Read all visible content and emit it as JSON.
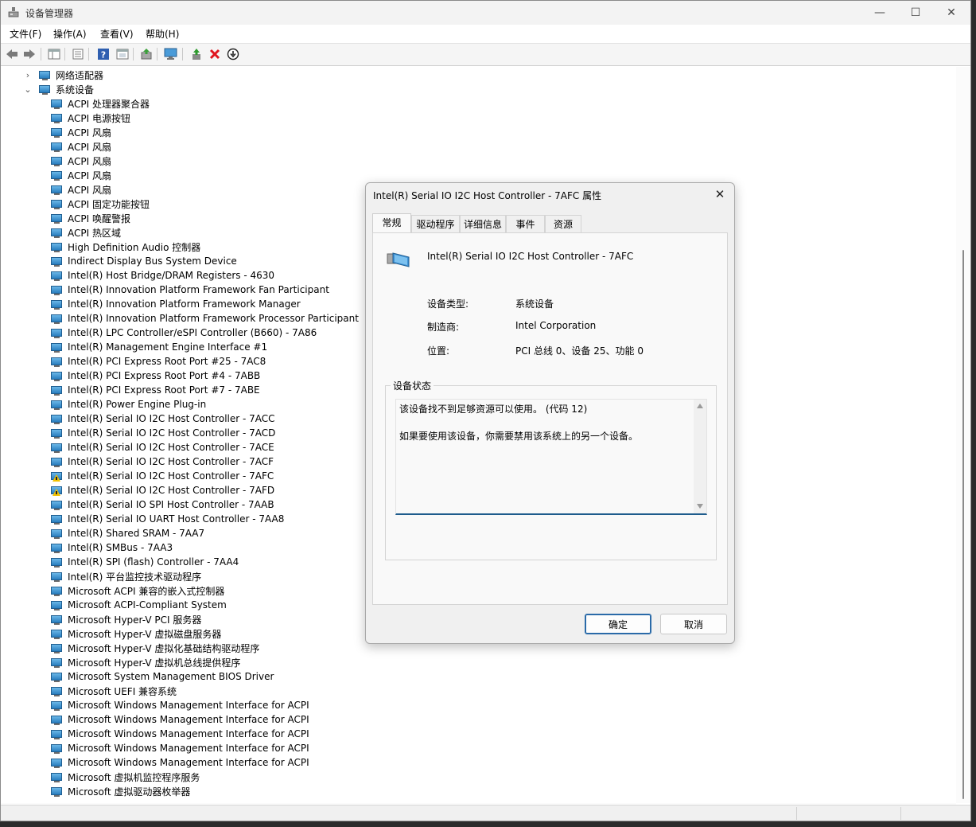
{
  "window": {
    "title": "设备管理器",
    "controls": {
      "minimize": "—",
      "maximize": "☐",
      "close": "✕"
    }
  },
  "menu": [
    "文件(F)",
    "操作(A)",
    "查看(V)",
    "帮助(H)"
  ],
  "toolbar": [
    "back-icon",
    "forward-icon",
    "properties-icon",
    "list-icon",
    "help-icon",
    "view-icon",
    "update-driver-icon",
    "monitor-icon",
    "enable-device-icon",
    "uninstall-icon",
    "disable-device-icon"
  ],
  "tree": {
    "categories": [
      {
        "label": "网络适配器",
        "expanded": false
      },
      {
        "label": "系统设备",
        "expanded": true
      }
    ],
    "devices": [
      {
        "label": "ACPI 处理器聚合器",
        "warning": false
      },
      {
        "label": "ACPI 电源按钮",
        "warning": false
      },
      {
        "label": "ACPI 风扇",
        "warning": false
      },
      {
        "label": "ACPI 风扇",
        "warning": false
      },
      {
        "label": "ACPI 风扇",
        "warning": false
      },
      {
        "label": "ACPI 风扇",
        "warning": false
      },
      {
        "label": "ACPI 风扇",
        "warning": false
      },
      {
        "label": "ACPI 固定功能按钮",
        "warning": false
      },
      {
        "label": "ACPI 唤醒警报",
        "warning": false
      },
      {
        "label": "ACPI 热区域",
        "warning": false
      },
      {
        "label": "High Definition Audio 控制器",
        "warning": false
      },
      {
        "label": "Indirect Display Bus System Device",
        "warning": false
      },
      {
        "label": "Intel(R) Host Bridge/DRAM Registers - 4630",
        "warning": false
      },
      {
        "label": "Intel(R) Innovation Platform Framework Fan Participant",
        "warning": false
      },
      {
        "label": "Intel(R) Innovation Platform Framework Manager",
        "warning": false
      },
      {
        "label": "Intel(R) Innovation Platform Framework Processor Participant",
        "warning": false
      },
      {
        "label": "Intel(R) LPC Controller/eSPI Controller (B660) - 7A86",
        "warning": false
      },
      {
        "label": "Intel(R) Management Engine Interface #1",
        "warning": false
      },
      {
        "label": "Intel(R) PCI Express Root Port #25 - 7AC8",
        "warning": false
      },
      {
        "label": "Intel(R) PCI Express Root Port #4 - 7ABB",
        "warning": false
      },
      {
        "label": "Intel(R) PCI Express Root Port #7 - 7ABE",
        "warning": false
      },
      {
        "label": "Intel(R) Power Engine Plug-in",
        "warning": false
      },
      {
        "label": "Intel(R) Serial IO I2C Host Controller - 7ACC",
        "warning": false
      },
      {
        "label": "Intel(R) Serial IO I2C Host Controller - 7ACD",
        "warning": false
      },
      {
        "label": "Intel(R) Serial IO I2C Host Controller - 7ACE",
        "warning": false
      },
      {
        "label": "Intel(R) Serial IO I2C Host Controller - 7ACF",
        "warning": false
      },
      {
        "label": "Intel(R) Serial IO I2C Host Controller - 7AFC",
        "warning": true
      },
      {
        "label": "Intel(R) Serial IO I2C Host Controller - 7AFD",
        "warning": true
      },
      {
        "label": "Intel(R) Serial IO SPI Host Controller - 7AAB",
        "warning": false
      },
      {
        "label": "Intel(R) Serial IO UART Host Controller - 7AA8",
        "warning": false
      },
      {
        "label": "Intel(R) Shared SRAM - 7AA7",
        "warning": false
      },
      {
        "label": "Intel(R) SMBus - 7AA3",
        "warning": false
      },
      {
        "label": "Intel(R) SPI (flash) Controller - 7AA4",
        "warning": false
      },
      {
        "label": "Intel(R) 平台监控技术驱动程序",
        "warning": false
      },
      {
        "label": "Microsoft ACPI 兼容的嵌入式控制器",
        "warning": false
      },
      {
        "label": "Microsoft ACPI-Compliant System",
        "warning": false
      },
      {
        "label": "Microsoft Hyper-V PCI 服务器",
        "warning": false
      },
      {
        "label": "Microsoft Hyper-V 虚拟磁盘服务器",
        "warning": false
      },
      {
        "label": "Microsoft Hyper-V 虚拟化基础结构驱动程序",
        "warning": false
      },
      {
        "label": "Microsoft Hyper-V 虚拟机总线提供程序",
        "warning": false
      },
      {
        "label": "Microsoft System Management BIOS Driver",
        "warning": false
      },
      {
        "label": "Microsoft UEFI 兼容系统",
        "warning": false
      },
      {
        "label": "Microsoft Windows Management Interface for ACPI",
        "warning": false
      },
      {
        "label": "Microsoft Windows Management Interface for ACPI",
        "warning": false
      },
      {
        "label": "Microsoft Windows Management Interface for ACPI",
        "warning": false
      },
      {
        "label": "Microsoft Windows Management Interface for ACPI",
        "warning": false
      },
      {
        "label": "Microsoft Windows Management Interface for ACPI",
        "warning": false
      },
      {
        "label": "Microsoft 虚拟机监控程序服务",
        "warning": false
      },
      {
        "label": "Microsoft 虚拟驱动器枚举器",
        "warning": false
      }
    ]
  },
  "dialog": {
    "title": "Intel(R) Serial IO I2C Host Controller - 7AFC 属性",
    "close": "✕",
    "tabs": [
      "常规",
      "驱动程序",
      "详细信息",
      "事件",
      "资源"
    ],
    "active_tab": 0,
    "device_name": "Intel(R) Serial IO I2C Host Controller - 7AFC",
    "properties": [
      {
        "label": "设备类型:",
        "value": "系统设备"
      },
      {
        "label": "制造商:",
        "value": "Intel Corporation"
      },
      {
        "label": "位置:",
        "value": "PCI 总线 0、设备 25、功能 0"
      }
    ],
    "status_group_label": "设备状态",
    "status_lines": [
      "该设备找不到足够资源可以使用。 (代码 12)",
      "如果要使用该设备，你需要禁用该系统上的另一个设备。"
    ],
    "ok_label": "确定",
    "cancel_label": "取消"
  }
}
